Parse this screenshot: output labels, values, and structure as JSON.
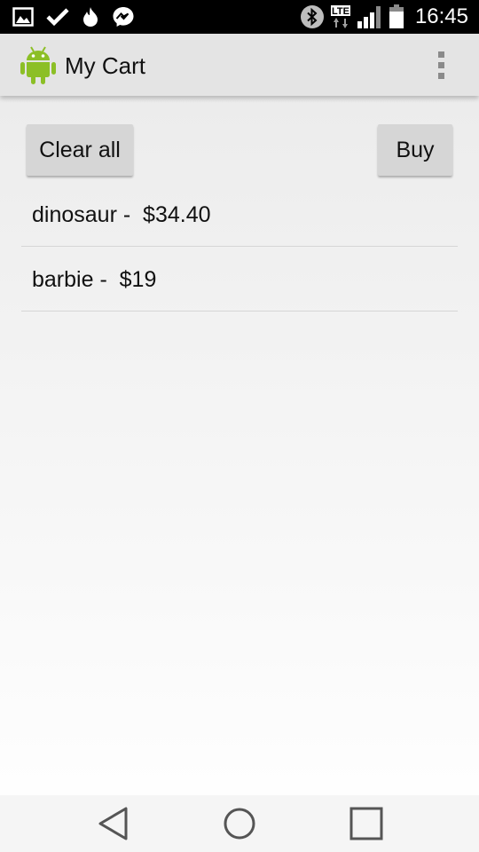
{
  "status_bar": {
    "time": "16:45",
    "left_icons": [
      "gallery-icon",
      "checkmark-icon",
      "flame-icon",
      "messenger-icon"
    ],
    "right_icons": [
      "bluetooth-icon",
      "lte-icon",
      "signal-icon",
      "battery-icon"
    ],
    "lte_label": "LTE"
  },
  "action_bar": {
    "title": "My Cart",
    "icon": "android-robot-icon"
  },
  "buttons": {
    "clear_all": "Clear all",
    "buy": "Buy"
  },
  "cart": {
    "items": [
      {
        "label": "dinosaur -  $34.40"
      },
      {
        "label": "barbie -  $19"
      }
    ]
  },
  "colors": {
    "android_green": "#8cbf26",
    "action_bar_bg": "#e4e4e4",
    "button_bg": "#d6d6d6"
  },
  "nav_bar": {
    "icons": [
      "back-icon",
      "home-icon",
      "recents-icon"
    ]
  }
}
